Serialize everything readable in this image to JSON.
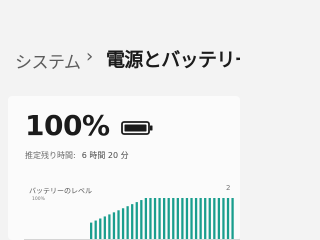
{
  "breadcrumb": {
    "parent": "システム",
    "separator": "›",
    "current": "電源とバッテリー"
  },
  "battery": {
    "percent_text": "100%",
    "level": 1.0,
    "remaining_label": "推定残り時間:",
    "remaining_value": "6 時間 20 分"
  },
  "chart": {
    "title": "バッテリーのレベル",
    "side_label": "2",
    "y_tick": "100%",
    "bar_color": "#1a9e8e"
  },
  "icons": {
    "battery": "battery-full-icon"
  },
  "chart_data": {
    "type": "bar",
    "title": "バッテリーのレベル",
    "ylabel": "",
    "ylim": [
      0,
      100
    ],
    "y_ticks": [
      "100%"
    ],
    "values": [
      40,
      45,
      50,
      55,
      60,
      65,
      70,
      75,
      80,
      85,
      90,
      95,
      100,
      100,
      100,
      100,
      100,
      100,
      100,
      100,
      100,
      100,
      100,
      100,
      100,
      100,
      100,
      100,
      100,
      100,
      100,
      100
    ]
  }
}
